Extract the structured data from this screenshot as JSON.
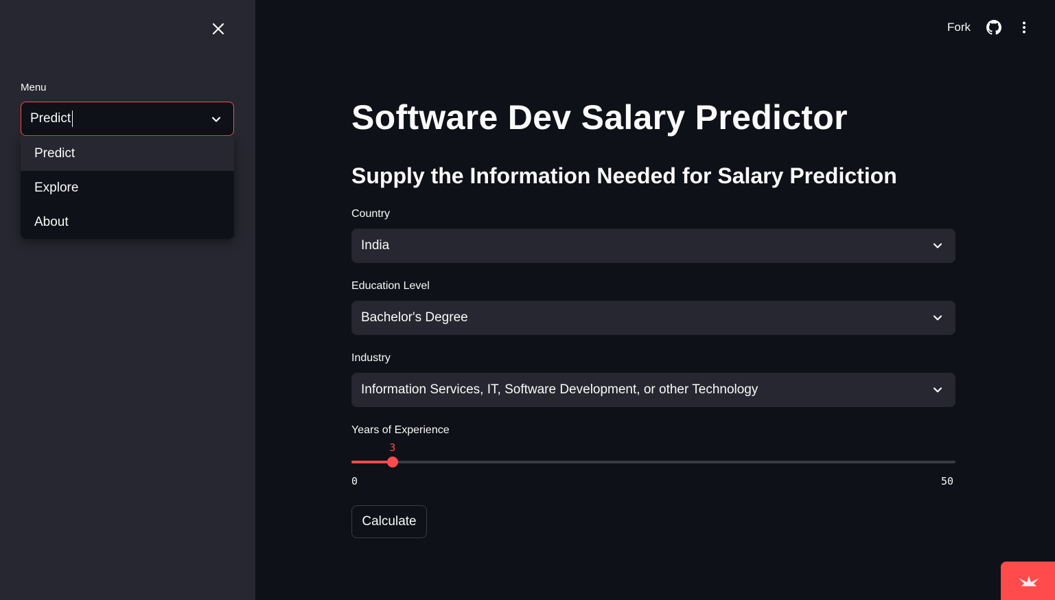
{
  "sidebar": {
    "menu_label": "Menu",
    "menu_value": "Predict",
    "menu_options": [
      "Predict",
      "Explore",
      "About"
    ],
    "close_icon": "close-icon"
  },
  "header": {
    "fork_label": "Fork",
    "github_icon": "github-icon",
    "more_icon": "kebab-menu-icon"
  },
  "main": {
    "title": "Software Dev Salary Predictor",
    "subtitle": "Supply the Information Needed for Salary Prediction",
    "country": {
      "label": "Country",
      "value": "India"
    },
    "education": {
      "label": "Education Level",
      "value": "Bachelor's Degree"
    },
    "industry": {
      "label": "Industry",
      "value": "Information Services, IT, Software Development, or other Technology"
    },
    "experience": {
      "label": "Years of Experience",
      "value": 3,
      "min": 0,
      "max": 50,
      "value_label": "3",
      "min_label": "0",
      "max_label": "50"
    },
    "calculate_label": "Calculate"
  },
  "colors": {
    "accent": "#ff4b4b",
    "background": "#0e1117",
    "sidebar": "#262730",
    "input_bg": "#262730",
    "text": "#fafafa"
  }
}
